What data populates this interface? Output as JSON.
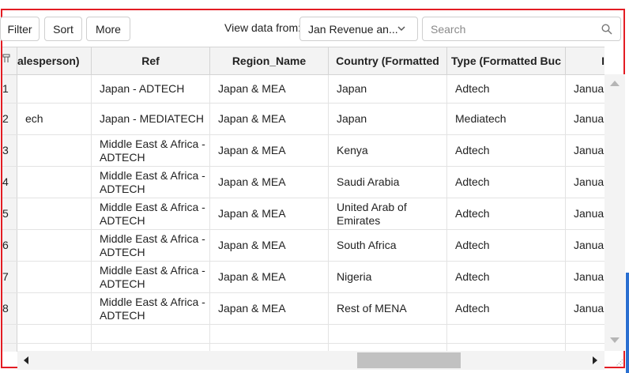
{
  "toolbar": {
    "filter_label": "Filter",
    "sort_label": "Sort",
    "more_label": "More",
    "view_label": "View data from:",
    "view_selected": "Jan Revenue an...",
    "search_placeholder": "Search"
  },
  "table": {
    "headers": [
      "alesperson)",
      "Ref",
      "Region_Name",
      "Country (Formatted",
      "Type (Formatted Buc",
      "I"
    ],
    "rows": [
      {
        "num": "1",
        "salesperson": "",
        "ref": "Japan - ADTECH",
        "region": "Japan & MEA",
        "country": "Japan",
        "type": "Adtech",
        "date": "Januar"
      },
      {
        "num": "2",
        "salesperson": "ech",
        "ref": "Japan - MEDIATECH",
        "region": "Japan & MEA",
        "country": "Japan",
        "type": "Mediatech",
        "date": "Januar"
      },
      {
        "num": "3",
        "salesperson": "",
        "ref": "Middle East & Africa - ADTECH",
        "region": "Japan & MEA",
        "country": "Kenya",
        "type": "Adtech",
        "date": "Januar"
      },
      {
        "num": "4",
        "salesperson": "",
        "ref": "Middle East & Africa - ADTECH",
        "region": "Japan & MEA",
        "country": "Saudi Arabia",
        "type": "Adtech",
        "date": "Januar"
      },
      {
        "num": "5",
        "salesperson": "",
        "ref": "Middle East & Africa - ADTECH",
        "region": "Japan & MEA",
        "country": "United Arab of Emirates",
        "type": "Adtech",
        "date": "Januar"
      },
      {
        "num": "6",
        "salesperson": "",
        "ref": "Middle East & Africa - ADTECH",
        "region": "Japan & MEA",
        "country": "South Africa",
        "type": "Adtech",
        "date": "Januar"
      },
      {
        "num": "7",
        "salesperson": "",
        "ref": "Middle East & Africa - ADTECH",
        "region": "Japan & MEA",
        "country": "Nigeria",
        "type": "Adtech",
        "date": "Januar"
      },
      {
        "num": "8",
        "salesperson": "",
        "ref": "Middle East & Africa - ADTECH",
        "region": "Japan & MEA",
        "country": "Rest of MENA",
        "type": "Adtech",
        "date": "Januar"
      }
    ]
  },
  "colors": {
    "frame": "#e31c23",
    "header_bg": "#f3f3f3",
    "accent": "#2a6fd1"
  },
  "icons": [
    "chevron-down-icon",
    "search-icon",
    "column-pin-icon",
    "scroll-up-icon",
    "scroll-down-icon",
    "scroll-left-icon",
    "scroll-right-icon",
    "resize-grip-icon"
  ]
}
